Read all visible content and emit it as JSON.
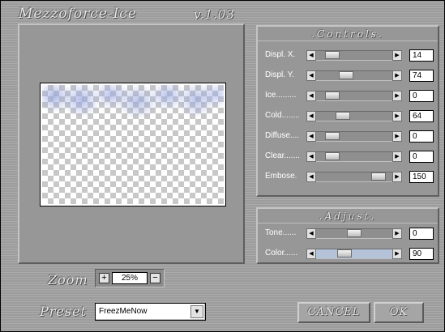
{
  "window": {
    "title": "Mezzoforce-Ice",
    "version": "v.1.03"
  },
  "controls": {
    "header": ".Controls.",
    "rows": [
      {
        "label": "Displ. X.",
        "value": "14",
        "level": 0.14
      },
      {
        "label": "Displ. Y.",
        "value": "74",
        "level": 0.37
      },
      {
        "label": "Ice.........",
        "value": "0",
        "level": 0.15
      },
      {
        "label": "Cold........",
        "value": "64",
        "level": 0.32
      },
      {
        "label": "Diffuse....",
        "value": "0",
        "level": 0.15
      },
      {
        "label": "Clear.......",
        "value": "0",
        "level": 0.15
      },
      {
        "label": "Embose.",
        "value": "150",
        "level": 0.89
      }
    ]
  },
  "adjust": {
    "header": ".Adjust.",
    "rows": [
      {
        "label": "Tone......",
        "value": "0",
        "level": 0.5,
        "color_track": false
      },
      {
        "label": "Color......",
        "value": "90",
        "level": 0.34,
        "color_track": true,
        "track_color": "#b5c3d9"
      }
    ]
  },
  "zoom": {
    "label": "Zoom",
    "value": "25%",
    "plus": "+",
    "minus": "−"
  },
  "preset": {
    "label": "Preset",
    "selected": "FreezMeNow"
  },
  "buttons": {
    "cancel": "CANCEL",
    "ok": "OK"
  },
  "icons": {
    "slider_left": "triangle-left-icon",
    "slider_right": "triangle-right-icon",
    "dropdown": "triangle-down-icon"
  }
}
